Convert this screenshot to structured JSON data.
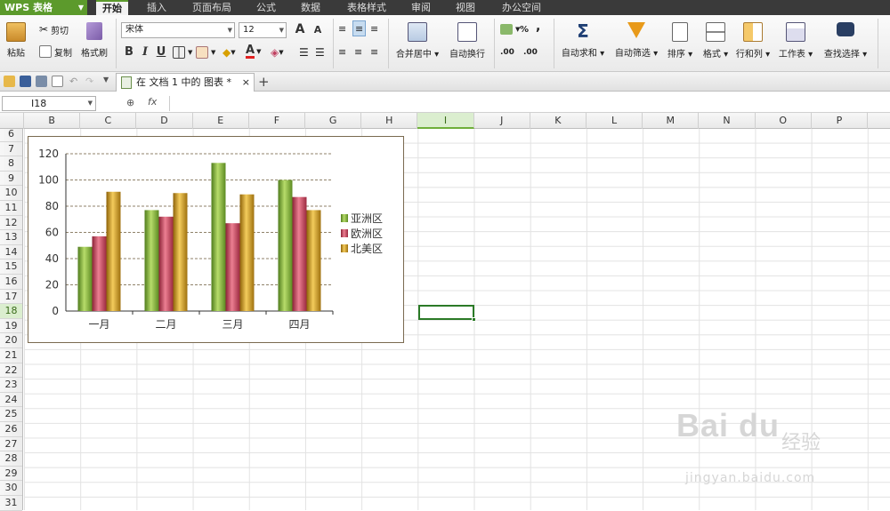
{
  "app": {
    "title": "WPS 表格"
  },
  "menu": {
    "tabs": [
      "开始",
      "插入",
      "页面布局",
      "公式",
      "数据",
      "表格样式",
      "审阅",
      "视图",
      "办公空间"
    ],
    "active": 0
  },
  "ribbon": {
    "paste": "粘贴",
    "cut": "剪切",
    "copy": "复制",
    "format_painter": "格式刷",
    "font_name": "宋体",
    "font_size": "12",
    "merge_center": "合并居中",
    "wrap_text": "自动换行",
    "autosum": "自动求和",
    "autofilter": "自动筛选",
    "sort": "排序",
    "format": "格式",
    "row_col": "行和列",
    "worksheet": "工作表",
    "find_select": "查找选择",
    "bold": "B",
    "italic": "I",
    "underline": "U",
    "percent": "%",
    "comma": ",",
    "grow_font": "A",
    "shrink_font": "A",
    "font_color": "A",
    "inc_decimal": ".00",
    "dec_decimal": ".00",
    "sigma": "Σ"
  },
  "doc_tab": {
    "title": "在 文档 1 中的 图表 *",
    "close": "×",
    "add": "+"
  },
  "formula_bar": {
    "name_box": "I18",
    "fx": "fx",
    "zoom": "⊕",
    "value": ""
  },
  "columns": [
    "B",
    "C",
    "D",
    "E",
    "F",
    "G",
    "H",
    "I",
    "J",
    "K",
    "L",
    "M",
    "N",
    "O",
    "P"
  ],
  "selected_column": "I",
  "rows": [
    "6",
    "7",
    "8",
    "9",
    "10",
    "11",
    "12",
    "13",
    "14",
    "15",
    "16",
    "17",
    "18",
    "19",
    "20",
    "21",
    "22",
    "23",
    "24",
    "25",
    "26",
    "27",
    "28",
    "29",
    "30",
    "31"
  ],
  "selected_row": "18",
  "chart_data": {
    "type": "bar",
    "categories": [
      "一月",
      "二月",
      "三月",
      "四月"
    ],
    "series": [
      {
        "name": "亚洲区",
        "values": [
          49,
          77,
          113,
          100
        ],
        "color": "#7fb03a"
      },
      {
        "name": "欧洲区",
        "values": [
          57,
          72,
          67,
          87
        ],
        "color": "#c4435a"
      },
      {
        "name": "北美区",
        "values": [
          91,
          90,
          89,
          77
        ],
        "color": "#c89520"
      }
    ],
    "yticks": [
      "0",
      "20",
      "40",
      "60",
      "80",
      "100",
      "120"
    ],
    "ylim": [
      0,
      120
    ],
    "grid": true,
    "legend": "right",
    "title": "",
    "xlabel": "",
    "ylabel": ""
  },
  "watermark": {
    "logo": "Bai du",
    "cn": "经验",
    "url": "jingyan.baidu.com"
  }
}
